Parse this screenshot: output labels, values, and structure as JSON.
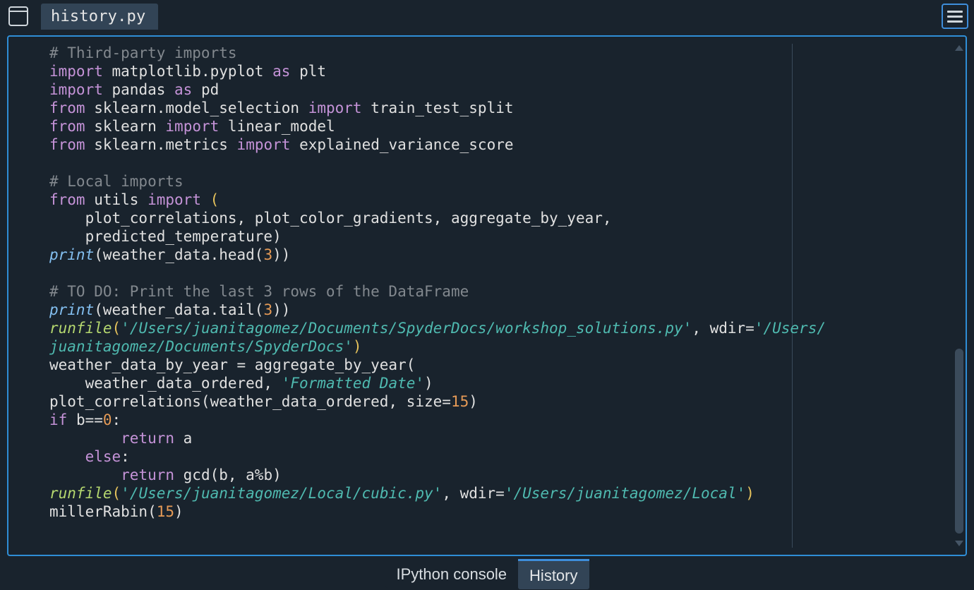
{
  "top": {
    "file_tab_label": "history.py"
  },
  "code": {
    "l1_comment": "# Third-party imports",
    "l2": {
      "import": "import",
      "mod": "matplotlib.pyplot",
      "as": "as",
      "alias": "plt"
    },
    "l3": {
      "import": "import",
      "mod": "pandas",
      "as": "as",
      "alias": "pd"
    },
    "l4": {
      "from": "from",
      "mod": "sklearn.model_selection",
      "import": "import",
      "name": "train_test_split"
    },
    "l5": {
      "from": "from",
      "mod": "sklearn",
      "import": "import",
      "name": "linear_model"
    },
    "l6": {
      "from": "from",
      "mod": "sklearn.metrics",
      "import": "import",
      "name": "explained_variance_score"
    },
    "l8_comment": "# Local imports",
    "l9": {
      "from": "from",
      "mod": "utils",
      "import": "import",
      "open": "("
    },
    "l10": "    plot_correlations, plot_color_gradients, aggregate_by_year,",
    "l11": "    predicted_temperature)",
    "l12": {
      "print": "print",
      "expr": "(weather_data.head(",
      "num": "3",
      "close": "))"
    },
    "l14_comment": "# TO DO: Print the last 3 rows of the DataFrame",
    "l15": {
      "print": "print",
      "expr": "(weather_data.tail(",
      "num": "3",
      "close": "))"
    },
    "l16": {
      "fn": "runfile",
      "open": "(",
      "s1": "'/Users/juanitagomez/Documents/SpyderDocs/workshop_solutions.py'",
      "mid": ", wdir=",
      "s2": "'/Users/"
    },
    "l17": {
      "s2b": "juanitagomez/Documents/SpyderDocs'",
      "close": ")"
    },
    "l18": "weather_data_by_year = aggregate_by_year(",
    "l19": {
      "indent": "    weather_data_ordered, ",
      "s": "'Formatted Date'",
      "close": ")"
    },
    "l20": {
      "a": "plot_correlations(weather_data_ordered, size=",
      "num": "15",
      "close": ")"
    },
    "l21": {
      "if": "if",
      "body": " b==",
      "num": "0",
      "colon": ":"
    },
    "l22": {
      "indent": "        ",
      "return": "return",
      "body": " a"
    },
    "l23": {
      "indent": "    ",
      "else": "else",
      "colon": ":"
    },
    "l24": {
      "indent": "        ",
      "return": "return",
      "body": " gcd(b, a%b)"
    },
    "l25": {
      "fn": "runfile",
      "open": "(",
      "s1": "'/Users/juanitagomez/Local/cubic.py'",
      "mid": ", wdir=",
      "s2": "'/Users/juanitagomez/Local'",
      "close": ")"
    },
    "l26": {
      "a": "millerRabin(",
      "num": "15",
      "close": ")"
    }
  },
  "bottom_tabs": {
    "ipython": "IPython console",
    "history": "History"
  }
}
